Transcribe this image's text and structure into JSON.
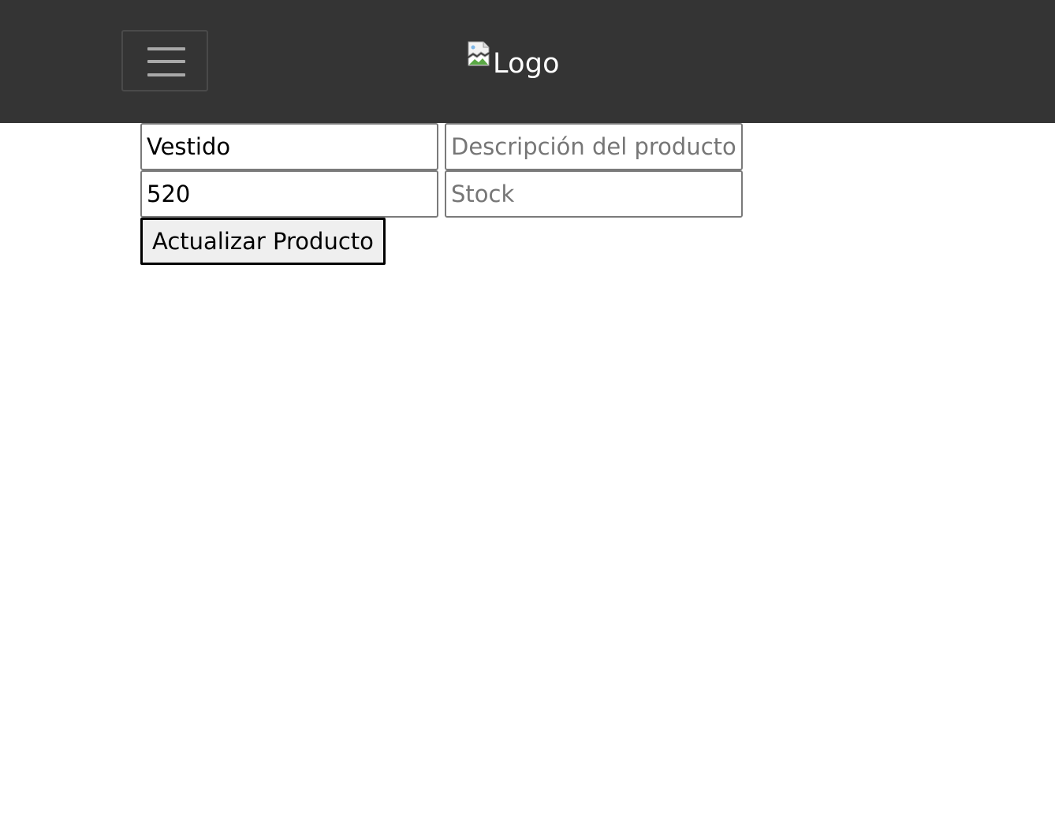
{
  "header": {
    "menu_button": {
      "icon": "hamburger-menu-icon"
    },
    "logo": {
      "alt_text": "Logo",
      "icon": "broken-image-icon"
    },
    "background_color": "#343434"
  },
  "form": {
    "name": {
      "value": "Vestido",
      "placeholder": ""
    },
    "description": {
      "value": "",
      "placeholder": "Descripción del producto"
    },
    "price": {
      "value": "520",
      "placeholder": ""
    },
    "stock": {
      "value": "",
      "placeholder": "Stock"
    },
    "submit_label": "Actualizar Producto"
  }
}
